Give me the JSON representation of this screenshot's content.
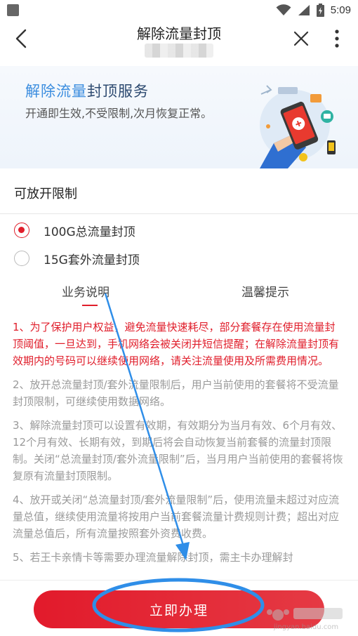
{
  "status_bar": {
    "time": "5:09"
  },
  "nav": {
    "title": "解除流量封顶"
  },
  "banner": {
    "title_part1": "解除流量",
    "title_part2": "封顶服务",
    "subtitle": "开通即生效,不受限制,次月恢复正常。"
  },
  "limit_section": {
    "title": "可放开限制"
  },
  "options": [
    {
      "label": "100G总流量封顶",
      "checked": true
    },
    {
      "label": "15G套外流量封顶",
      "checked": false
    }
  ],
  "tabs": [
    {
      "label": "业务说明",
      "active": true
    },
    {
      "label": "温馨提示",
      "active": false
    }
  ],
  "content": {
    "para1": "1、为了保护用户权益，避免流量快速耗尽，部分套餐存在使用流量封顶阈值，一旦达到，手机网络会被关闭并短信提醒；在解除流量封顶有效期内的号码可以继续使用网络，请关注流量使用及所需费用情况。",
    "para2": "2、放开总流量封顶/套外流量限制后，用户当前使用的套餐将不受流量封顶限制，可继续使用数据网络。",
    "para3": "3、解除流量封顶可以设置有效期，有效期分为当月有效、6个月有效、12个月有效、长期有效，到期后将会自动恢复当前套餐的流量封顶限制。关闭“总流量封顶/套外流量限制”后，当月用户当前使用的套餐将恢复原有流量封顶限制。",
    "para4": "4、放开或关闭“总流量封顶/套外流量限制”后，使用流量未超过对应流量总值，继续使用流量将按用户当前套餐流量计费规则计费；超出对应流量总值后，所有流量按照套外资费收费。",
    "para5": "5、若王卡亲情卡等需要办理流量解除封顶，需主卡办理解封"
  },
  "footer": {
    "apply_label": "立即办理"
  },
  "watermark": {
    "text": "jingyan.baidu.com"
  },
  "colors": {
    "accent": "#e01e2b",
    "banner_blue": "#3b8ddf",
    "annotation_blue": "#2f8ee8"
  }
}
